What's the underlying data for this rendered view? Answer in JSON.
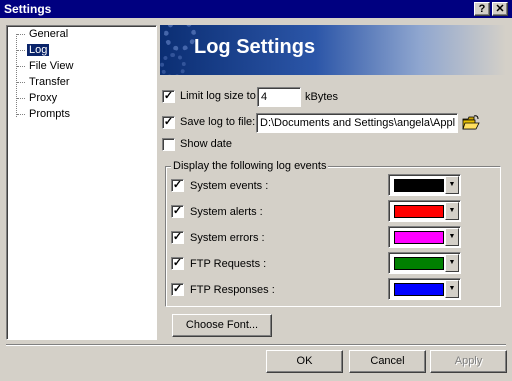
{
  "window": {
    "title": "Settings",
    "help_glyph": "?",
    "close_glyph": "✕"
  },
  "tree": {
    "items": [
      {
        "label": "General",
        "selected": false
      },
      {
        "label": "Log",
        "selected": true
      },
      {
        "label": "File View",
        "selected": false
      },
      {
        "label": "Transfer",
        "selected": false
      },
      {
        "label": "Proxy",
        "selected": false
      },
      {
        "label": "Prompts",
        "selected": false
      }
    ]
  },
  "banner": {
    "title": "Log Settings"
  },
  "options": {
    "limit_log": {
      "checked": true,
      "label": "Limit log size to",
      "value": "4",
      "unit": "kBytes"
    },
    "save_log": {
      "checked": true,
      "label": "Save log to file:",
      "value": "D:\\Documents and Settings\\angela\\Appl"
    },
    "show_date": {
      "checked": false,
      "label": "Show date"
    }
  },
  "events_group": {
    "title": "Display the following log events",
    "events": [
      {
        "label": "System events :",
        "checked": true,
        "color": "#000000"
      },
      {
        "label": "System alerts :",
        "checked": true,
        "color": "#ff0000"
      },
      {
        "label": "System errors :",
        "checked": true,
        "color": "#ff00ff"
      },
      {
        "label": "FTP Requests :",
        "checked": true,
        "color": "#008000"
      },
      {
        "label": "FTP Responses :",
        "checked": true,
        "color": "#0000ff"
      }
    ]
  },
  "buttons": {
    "choose_font": "Choose Font...",
    "ok": "OK",
    "cancel": "Cancel",
    "apply": "Apply",
    "apply_enabled": false
  },
  "glyphs": {
    "check": "✓",
    "dropdown": "▼"
  }
}
